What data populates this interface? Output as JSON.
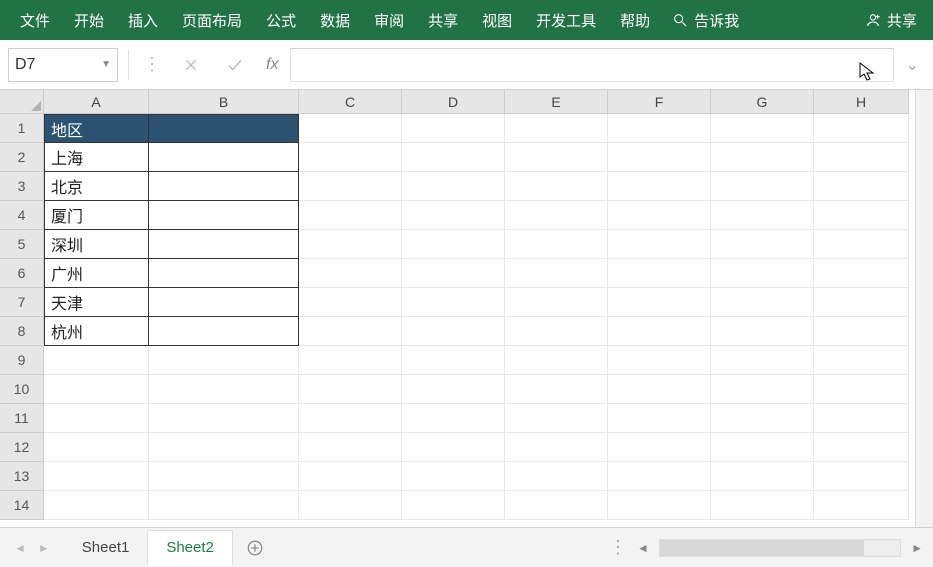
{
  "ribbon": {
    "items": [
      "文件",
      "开始",
      "插入",
      "页面布局",
      "公式",
      "数据",
      "审阅",
      "共享",
      "视图",
      "开发工具",
      "帮助"
    ],
    "tellme": "告诉我",
    "share": "共享"
  },
  "formula_bar": {
    "name_box": "D7",
    "fx_label": "fx",
    "formula_value": ""
  },
  "grid": {
    "columns": [
      "A",
      "B",
      "C",
      "D",
      "E",
      "F",
      "G",
      "H"
    ],
    "row_numbers": [
      1,
      2,
      3,
      4,
      5,
      6,
      7,
      8,
      9,
      10,
      11,
      12,
      13,
      14
    ],
    "data": {
      "A1": "地区",
      "A2": "上海",
      "A3": "北京",
      "A4": "厦门",
      "A5": "深圳",
      "A6": "广州",
      "A7": "天津",
      "A8": "杭州"
    },
    "bordered_range": {
      "cols": [
        "A",
        "B"
      ],
      "rows": [
        1,
        2,
        3,
        4,
        5,
        6,
        7,
        8
      ]
    },
    "header_fill_cells": [
      "A1",
      "B1"
    ]
  },
  "sheets": {
    "tabs": [
      "Sheet1",
      "Sheet2"
    ],
    "active": "Sheet2"
  },
  "colors": {
    "ribbon_bg": "#217346",
    "header_cell_bg": "#2b5371"
  }
}
